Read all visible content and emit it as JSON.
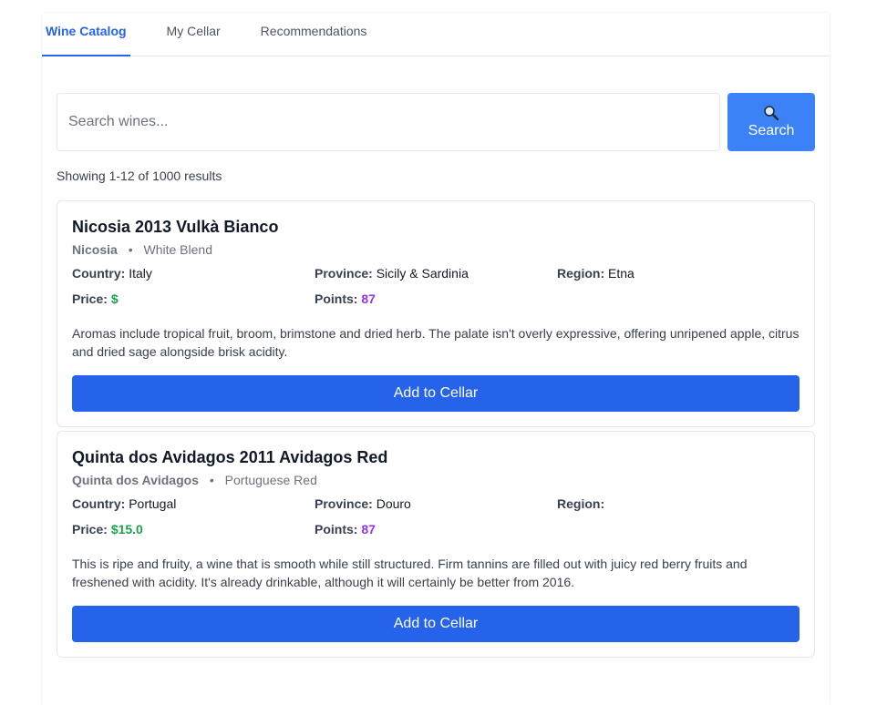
{
  "tabs": [
    {
      "label": "Wine Catalog",
      "active": true
    },
    {
      "label": "My Cellar",
      "active": false
    },
    {
      "label": "Recommendations",
      "active": false
    }
  ],
  "search": {
    "placeholder": "Search wines...",
    "value": "",
    "button_label": "Search",
    "button_icon": "magnifier-icon"
  },
  "results_text": "Showing 1-12 of 1000 results",
  "labels": {
    "country": "Country:",
    "province": "Province:",
    "region": "Region:",
    "price": "Price:",
    "points": "Points:",
    "add_button": "Add to Cellar",
    "separator": "•"
  },
  "wines": [
    {
      "title": "Nicosia 2013 Vulkà Bianco",
      "winery": "Nicosia",
      "variety": "White Blend",
      "country": "Italy",
      "province": "Sicily & Sardinia",
      "region": "Etna",
      "price": "$",
      "points": "87",
      "description": "Aromas include tropical fruit, broom, brimstone and dried herb. The palate isn't overly expressive, offering unripened apple, citrus and dried sage alongside brisk acidity."
    },
    {
      "title": "Quinta dos Avidagos 2011 Avidagos Red",
      "winery": "Quinta dos Avidagos",
      "variety": "Portuguese Red",
      "country": "Portugal",
      "province": "Douro",
      "region": "",
      "price": "$15.0",
      "points": "87",
      "description": "This is ripe and fruity, a wine that is smooth while still structured. Firm tannins are filled out with juicy red berry fruits and freshened with acidity. It's already drinkable, although it will certainly be better from 2016."
    }
  ],
  "colors": {
    "accent": "#2563eb",
    "search_button": "#3b82f6",
    "price": "#16a34a",
    "points": "#9333ea"
  }
}
